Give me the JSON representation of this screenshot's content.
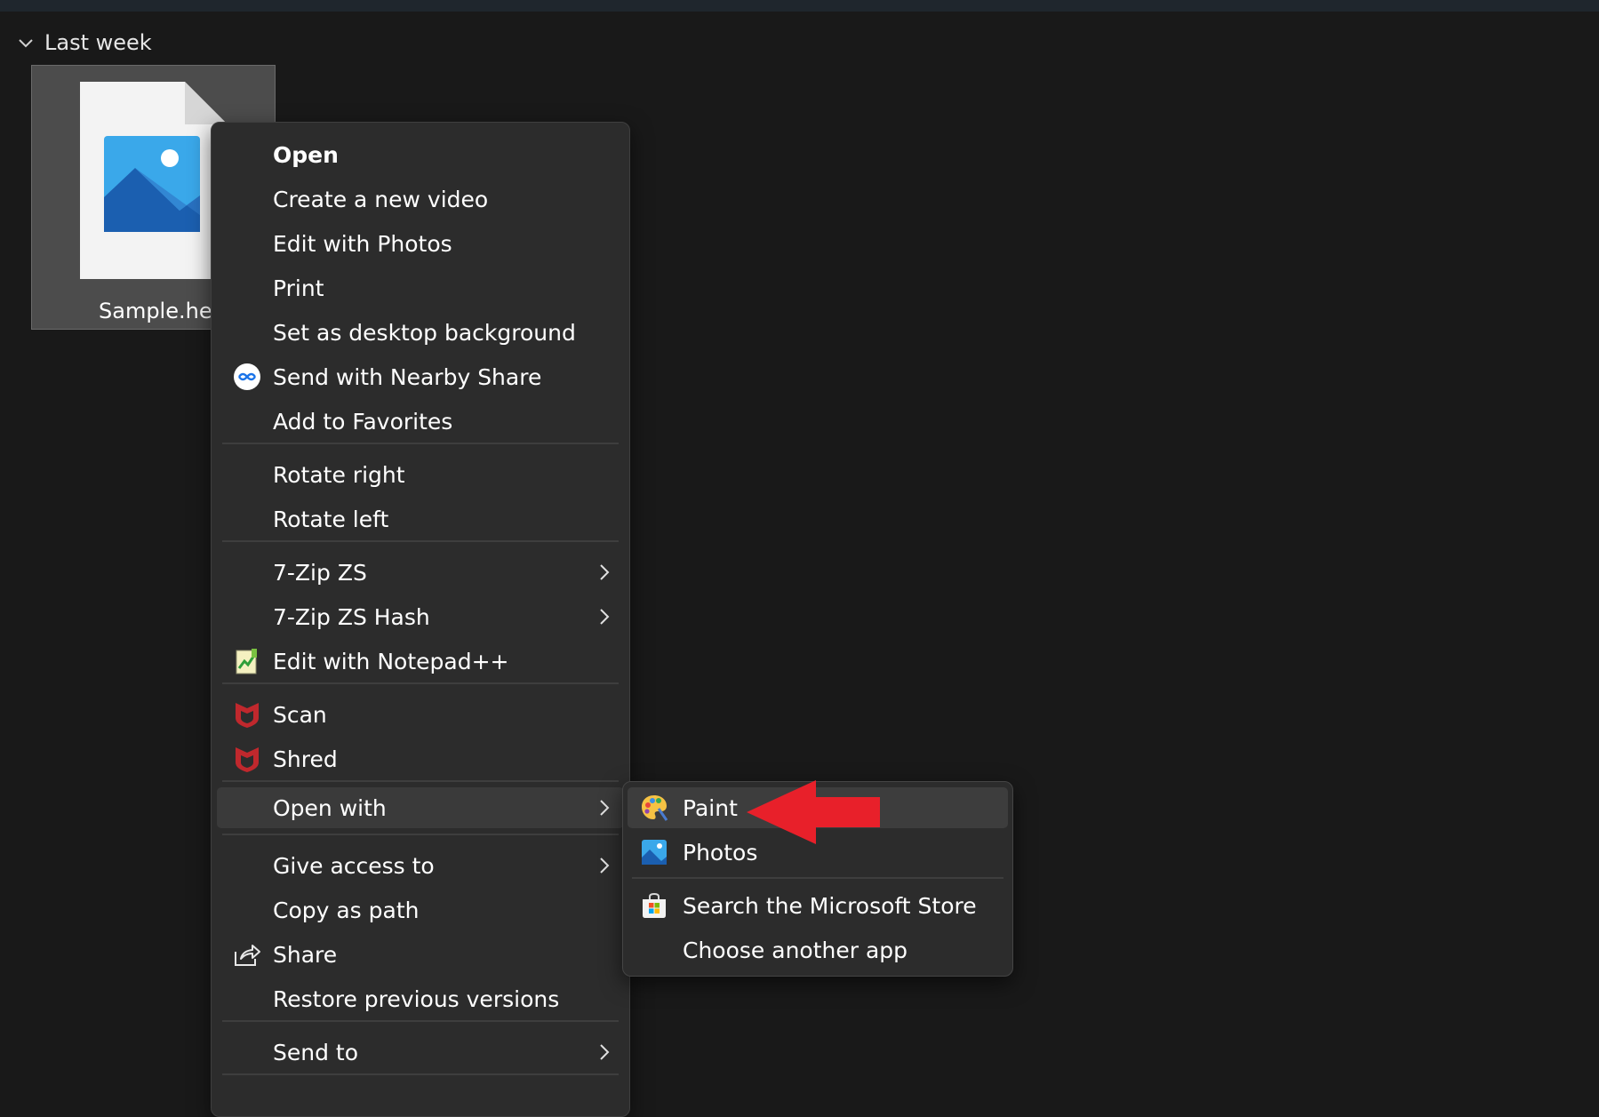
{
  "group": {
    "label": "Last week"
  },
  "file": {
    "name": "Sample.heic"
  },
  "context_menu": {
    "items": [
      {
        "label": "Open"
      },
      {
        "label": "Create a new video"
      },
      {
        "label": "Edit with Photos"
      },
      {
        "label": "Print"
      },
      {
        "label": "Set as desktop background"
      },
      {
        "label": "Send with Nearby Share"
      },
      {
        "label": "Add to Favorites"
      },
      {
        "label": "Rotate right"
      },
      {
        "label": "Rotate left"
      },
      {
        "label": "7-Zip ZS"
      },
      {
        "label": "7-Zip ZS Hash"
      },
      {
        "label": "Edit with Notepad++"
      },
      {
        "label": "Scan"
      },
      {
        "label": "Shred"
      },
      {
        "label": "Open with"
      },
      {
        "label": "Give access to"
      },
      {
        "label": "Copy as path"
      },
      {
        "label": "Share"
      },
      {
        "label": "Restore previous versions"
      },
      {
        "label": "Send to"
      }
    ]
  },
  "open_with_submenu": {
    "items": [
      {
        "label": "Paint"
      },
      {
        "label": "Photos"
      },
      {
        "label": "Search the Microsoft Store"
      },
      {
        "label": "Choose another app"
      }
    ]
  },
  "colors": {
    "background": "#191919",
    "menu": "#2c2c2c",
    "highlight": "#3a3a3a",
    "annotation_arrow": "#e8202a",
    "mcafee_red": "#c0282d"
  },
  "icons": {
    "nearby_share": "nearby-share-icon",
    "notepadpp": "notepad-plus-plus-icon",
    "mcafee": "mcafee-shield-icon",
    "share": "share-icon",
    "paint": "paint-palette-icon",
    "photos": "photos-icon",
    "store": "microsoft-store-icon"
  }
}
